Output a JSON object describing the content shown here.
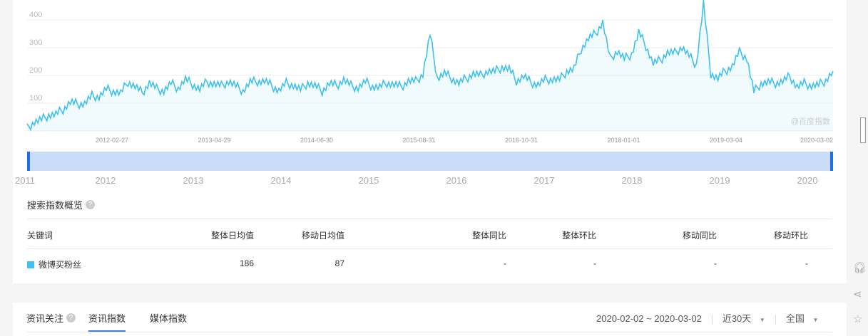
{
  "chart_data": {
    "type": "area",
    "title": "",
    "series": [
      {
        "name": "微博买粉丝",
        "color": "#3ec1f0"
      }
    ],
    "start": "2011-01",
    "step": "month",
    "values": [
      10,
      30,
      50,
      45,
      60,
      90,
      95,
      100,
      115,
      120,
      130,
      135,
      140,
      145,
      165,
      160,
      150,
      165,
      155,
      160,
      165,
      160,
      170,
      165,
      160,
      165,
      170,
      175,
      170,
      165,
      160,
      170,
      185,
      165,
      160,
      155,
      160,
      165,
      160,
      165,
      165,
      160,
      165,
      170,
      170,
      160,
      165,
      165,
      160,
      170,
      165,
      170,
      175,
      175,
      185,
      190,
      345,
      200,
      195,
      190,
      185,
      180,
      210,
      215,
      210,
      220,
      215,
      220,
      190,
      185,
      175,
      180,
      175,
      190,
      200,
      210,
      230,
      280,
      330,
      360,
      380,
      260,
      300,
      250,
      280,
      370,
      300,
      250,
      240,
      280,
      290,
      290,
      270,
      250,
      460,
      210,
      205,
      210,
      240,
      270,
      260,
      150,
      160,
      175,
      185,
      170,
      200,
      175,
      165,
      170,
      150,
      180,
      225
    ],
    "ylim": [
      0,
      400
    ],
    "yticks": [
      "100",
      "200",
      "300",
      "400"
    ],
    "xtick_labels": [
      "2012-02-27",
      "2013-04-29",
      "2014-06-30",
      "2015-08-31",
      "2016-10-31",
      "2018-01-01",
      "2019-03-04",
      "2020-03-02"
    ],
    "slider_years": [
      "2011",
      "2012",
      "2013",
      "2014",
      "2015",
      "2016",
      "2017",
      "2018",
      "2019",
      "2020"
    ],
    "watermark": "@百度指数",
    "grid": true
  },
  "overview": {
    "title": "搜索指数概览",
    "headers": [
      "关键词",
      "整体日均值",
      "移动日均值",
      "整体同比",
      "整体环比",
      "移动同比",
      "移动环比"
    ],
    "rows": [
      {
        "keyword": "微博买粉丝",
        "color": "#3ec1f0",
        "values": [
          "186",
          "87",
          "-",
          "-",
          "-",
          "-"
        ]
      }
    ]
  },
  "bottom": {
    "label": "资讯关注",
    "tabs": [
      "资讯指数",
      "媒体指数"
    ],
    "date_range": "2020-02-02 ~ 2020-03-02",
    "period": "近30天",
    "region": "全国"
  }
}
